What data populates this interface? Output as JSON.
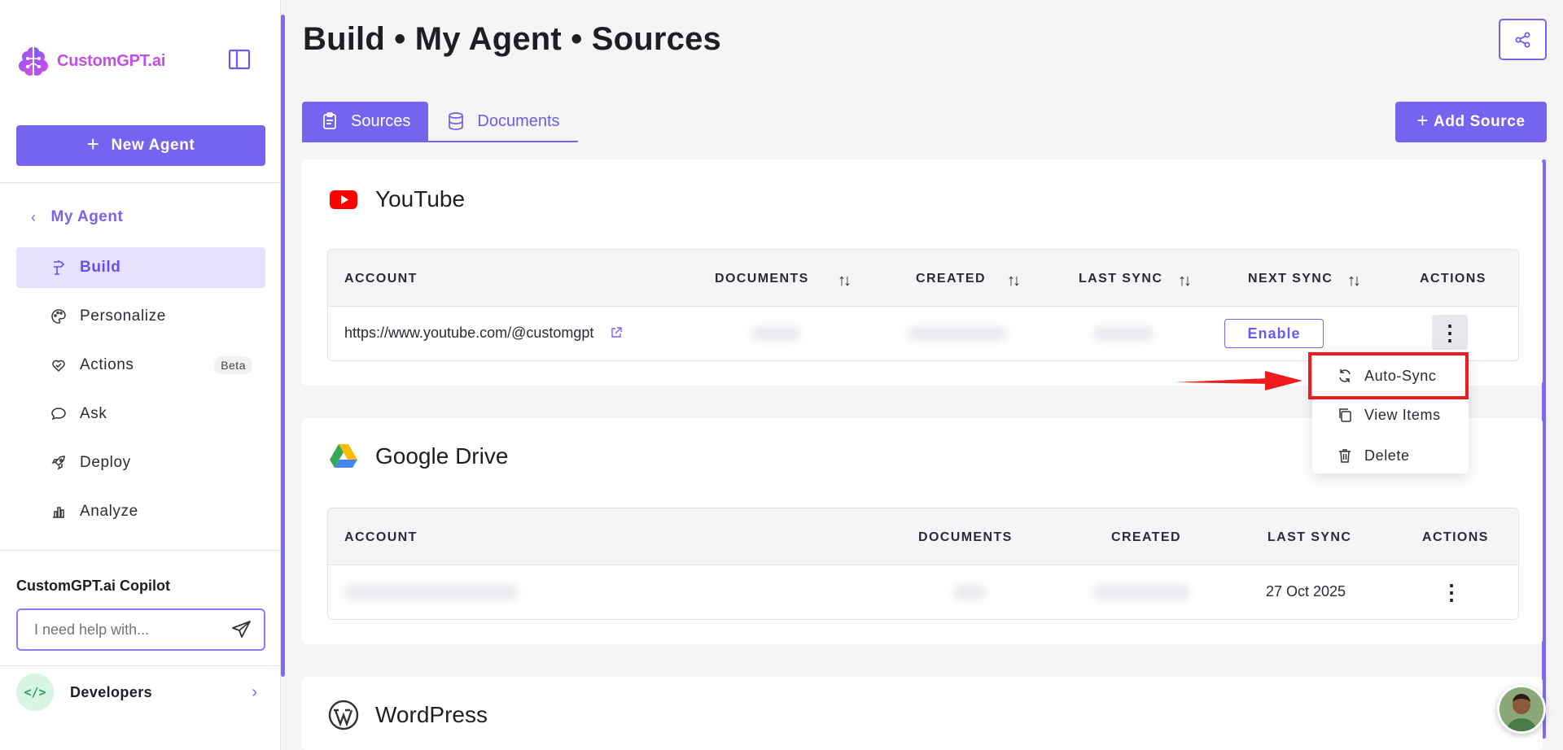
{
  "app": {
    "brand": "CustomGPT.ai",
    "page_title": "Build • My Agent • Sources"
  },
  "sidebar": {
    "new_agent_label": "New Agent",
    "back_label": "My Agent",
    "nav": [
      {
        "label": "Build",
        "icon": "build-icon",
        "active": true
      },
      {
        "label": "Personalize",
        "icon": "palette-icon"
      },
      {
        "label": "Actions",
        "icon": "heart-hand-icon",
        "badge": "Beta"
      },
      {
        "label": "Ask",
        "icon": "chat-icon"
      },
      {
        "label": "Deploy",
        "icon": "rocket-icon"
      },
      {
        "label": "Analyze",
        "icon": "bar-chart-icon"
      }
    ],
    "copilot_title": "CustomGPT.ai Copilot",
    "copilot_placeholder": "I need help with...",
    "developers_label": "Developers",
    "developers_icon_text": "</>"
  },
  "tabs": [
    {
      "label": "Sources",
      "active": true
    },
    {
      "label": "Documents"
    }
  ],
  "add_source_label": "Add Source",
  "youtube": {
    "title": "YouTube",
    "columns": [
      "ACCOUNT",
      "DOCUMENTS",
      "CREATED",
      "LAST SYNC",
      "NEXT SYNC",
      "ACTIONS"
    ],
    "row": {
      "account": "https://www.youtube.com/@customgpt",
      "next_sync_button": "Enable"
    }
  },
  "actions_menu": {
    "items": [
      {
        "label": "Auto-Sync",
        "icon": "refresh-icon"
      },
      {
        "label": "View Items",
        "icon": "copy-icon"
      },
      {
        "label": "Delete",
        "icon": "trash-icon"
      }
    ]
  },
  "google_drive": {
    "title": "Google Drive",
    "columns": [
      "ACCOUNT",
      "DOCUMENTS",
      "CREATED",
      "LAST SYNC",
      "ACTIONS"
    ],
    "row": {
      "last_sync": "27 Oct 2025"
    }
  },
  "wordpress": {
    "title": "WordPress"
  },
  "colors": {
    "accent": "#7664f0",
    "highlight": "#ee1c1c",
    "youtube_red": "#ff0000"
  }
}
